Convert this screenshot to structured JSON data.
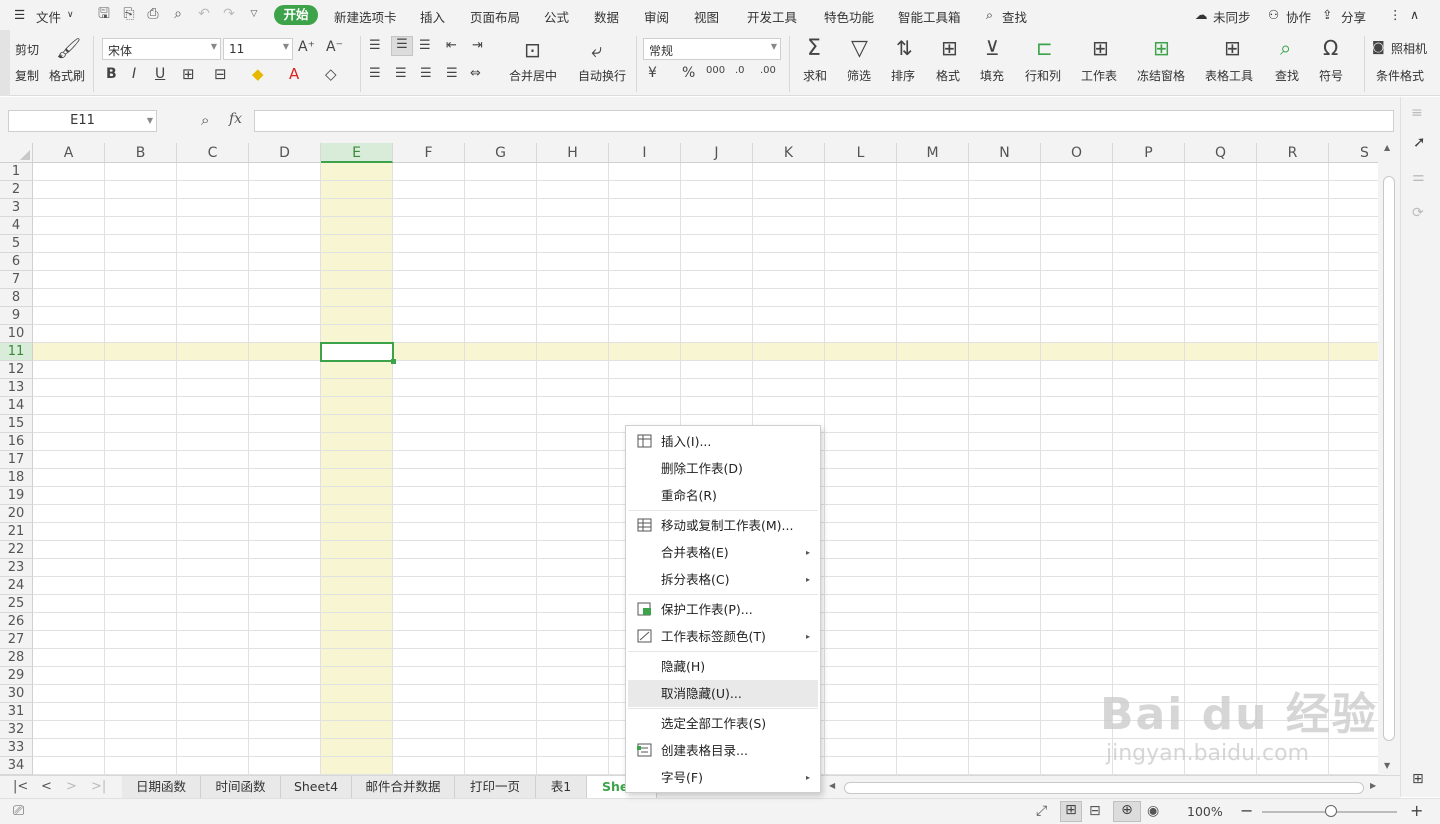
{
  "menubar": {
    "file": "文件",
    "tabs": [
      "开始",
      "新建选项卡",
      "插入",
      "页面布局",
      "公式",
      "数据",
      "审阅",
      "视图",
      "开发工具",
      "特色功能",
      "智能工具箱"
    ],
    "search": "查找",
    "sync": "未同步",
    "collab": "协作",
    "share": "分享"
  },
  "ribbon": {
    "cut": "剪切",
    "copy": "复制",
    "format_painter": "格式刷",
    "font_name": "宋体",
    "font_size": "11",
    "merge_center": "合并居中",
    "wrap_text": "自动换行",
    "number_format": "常规",
    "sum": "求和",
    "filter": "筛选",
    "sort": "排序",
    "format": "格式",
    "fill": "填充",
    "row_col": "行和列",
    "worksheet": "工作表",
    "freeze": "冻结窗格",
    "table_tools": "表格工具",
    "find": "查找",
    "symbol": "符号",
    "camera": "照相机",
    "cond_format": "条件格式"
  },
  "formula_bar": {
    "name_box": "E11",
    "fx": "fx",
    "value": ""
  },
  "grid": {
    "columns": [
      "A",
      "B",
      "C",
      "D",
      "E",
      "F",
      "G",
      "H",
      "I",
      "J",
      "K",
      "L",
      "M",
      "N",
      "O",
      "P",
      "Q",
      "R",
      "S"
    ],
    "rows": [
      "1",
      "2",
      "3",
      "4",
      "5",
      "6",
      "7",
      "8",
      "9",
      "10",
      "11",
      "12",
      "13",
      "14",
      "15",
      "16",
      "17",
      "18",
      "19",
      "20",
      "21",
      "22",
      "23",
      "24",
      "25",
      "26",
      "27",
      "28",
      "29",
      "30",
      "31",
      "32",
      "33",
      "34"
    ],
    "active_column": "E",
    "active_row": "11"
  },
  "context_menu": {
    "items": [
      {
        "label": "插入(I)...",
        "icon": "insert-table-icon"
      },
      {
        "label": "删除工作表(D)"
      },
      {
        "label": "重命名(R)"
      },
      {
        "label": "移动或复制工作表(M)...",
        "icon": "move-copy-icon"
      },
      {
        "label": "合并表格(E)",
        "submenu": true
      },
      {
        "label": "拆分表格(C)",
        "submenu": true
      },
      {
        "label": "保护工作表(P)...",
        "icon": "protect-sheet-icon"
      },
      {
        "label": "工作表标签颜色(T)",
        "icon": "tab-color-icon",
        "submenu": true
      },
      {
        "label": "隐藏(H)"
      },
      {
        "label": "取消隐藏(U)...",
        "hover": true
      },
      {
        "label": "选定全部工作表(S)"
      },
      {
        "label": "创建表格目录...",
        "icon": "create-index-icon"
      },
      {
        "label": "字号(F)",
        "submenu": true
      }
    ]
  },
  "sheet_tabs": [
    "日期函数",
    "时间函数",
    "Sheet4",
    "邮件合并数据",
    "打印一页",
    "表1",
    "She"
  ],
  "status": {
    "zoom": "100%"
  },
  "watermark": {
    "brand": "Bai du 经验",
    "url": "jingyan.baidu.com"
  },
  "colors": {
    "accent": "#3da34a",
    "highlight": "#f8f6d2"
  }
}
